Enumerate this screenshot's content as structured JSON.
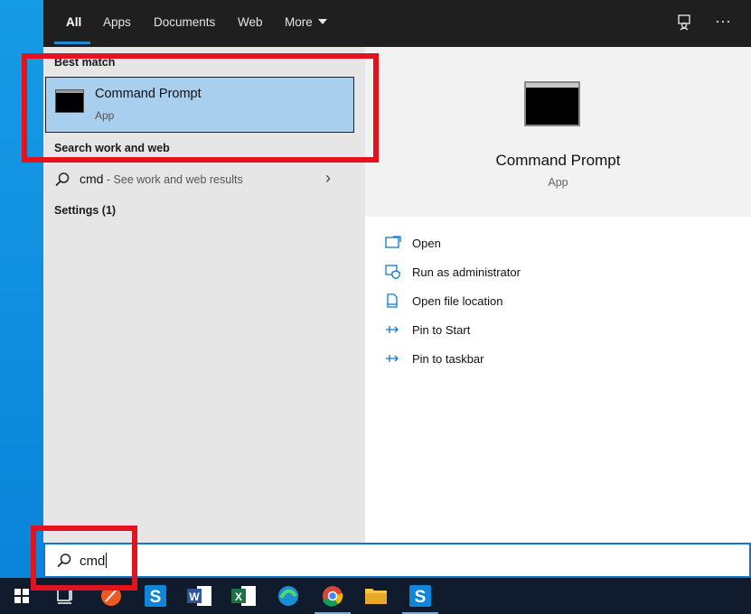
{
  "tabs": [
    {
      "label": "All",
      "active": true
    },
    {
      "label": "Apps"
    },
    {
      "label": "Documents"
    },
    {
      "label": "Web"
    },
    {
      "label": "More"
    }
  ],
  "best_match": {
    "section_label": "Best match",
    "title": "Command Prompt",
    "subtitle": "App"
  },
  "search_web": {
    "section_label": "Search work and web",
    "query": "cmd",
    "hint": " - See work and web results"
  },
  "settings_label": "Settings (1)",
  "detail": {
    "title": "Command Prompt",
    "subtitle": "App",
    "actions": [
      {
        "label": "Open",
        "icon": "open-window-icon"
      },
      {
        "label": "Run as administrator",
        "icon": "shield-icon"
      },
      {
        "label": "Open file location",
        "icon": "file-location-icon"
      },
      {
        "label": "Pin to Start",
        "icon": "pin-icon"
      },
      {
        "label": "Pin to taskbar",
        "icon": "pin-icon"
      }
    ]
  },
  "search_box": {
    "value": "cmd"
  },
  "taskbar": [
    "windows-start-icon",
    "task-view-icon",
    "paw-app-icon",
    "s-app-icon",
    "word-icon",
    "excel-icon",
    "edge-icon",
    "chrome-icon",
    "file-explorer-icon",
    "s-app-icon"
  ],
  "colors": {
    "accent": "#0e78d4",
    "annotation": "#e3131e",
    "selection": "#a9cfef",
    "topbar": "#1f1f1f"
  }
}
